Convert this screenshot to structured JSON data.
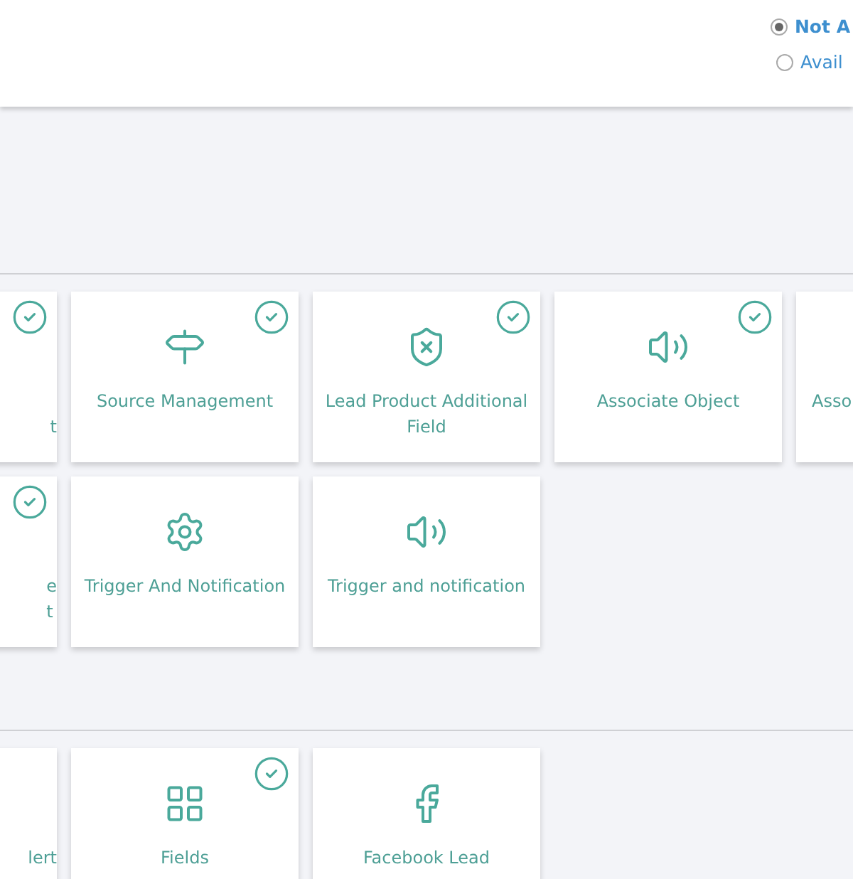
{
  "header": {
    "options": [
      {
        "label": "Not A",
        "selected": true
      },
      {
        "label": "Avail",
        "selected": false
      }
    ]
  },
  "sections": [
    {
      "rows": [
        [
          {
            "kind": "cut-left",
            "label": "\nt",
            "checked": true
          },
          {
            "kind": "full",
            "label": "Source Management",
            "checked": true
          },
          {
            "kind": "full",
            "label": "Lead Product Additional Field",
            "checked": true
          },
          {
            "kind": "full",
            "label": "Associate Object",
            "checked": true
          },
          {
            "kind": "cut-right",
            "label": "Asso"
          }
        ],
        [
          {
            "kind": "cut-left",
            "label": "e\nt",
            "checked": true
          },
          {
            "kind": "full",
            "label": "Trigger And Notification",
            "checked": false
          },
          {
            "kind": "full",
            "label": "Trigger and notification",
            "checked": false
          }
        ]
      ]
    },
    {
      "rows": [
        [
          {
            "kind": "cut-left",
            "label": "lert",
            "checked": false
          },
          {
            "kind": "full",
            "label": "Fields",
            "checked": true
          },
          {
            "kind": "full",
            "label": "Facebook Lead",
            "checked": false
          }
        ]
      ]
    }
  ]
}
